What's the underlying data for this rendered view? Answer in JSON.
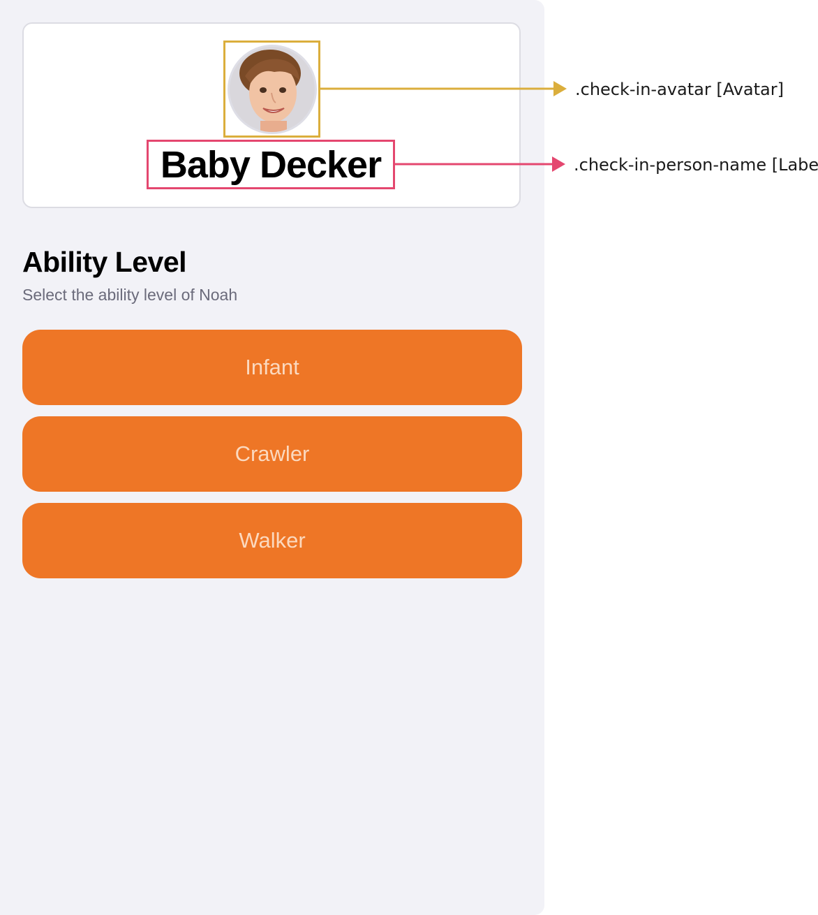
{
  "person_card": {
    "name": "Baby Decker",
    "avatar_icon": "child-portrait"
  },
  "ability": {
    "title": "Ability Level",
    "subtitle": "Select the ability level of Noah",
    "options": [
      {
        "label": "Infant"
      },
      {
        "label": "Crawler"
      },
      {
        "label": "Walker"
      }
    ]
  },
  "annotations": {
    "avatar_label": ".check-in-avatar [Avatar]",
    "name_label": ".check-in-person-name [Label]",
    "avatar_color": "#dbae3c",
    "name_color": "#e4476f"
  },
  "colors": {
    "background": "#f2f2f7",
    "button": "#ee7626",
    "button_text": "#fbd9bf"
  }
}
